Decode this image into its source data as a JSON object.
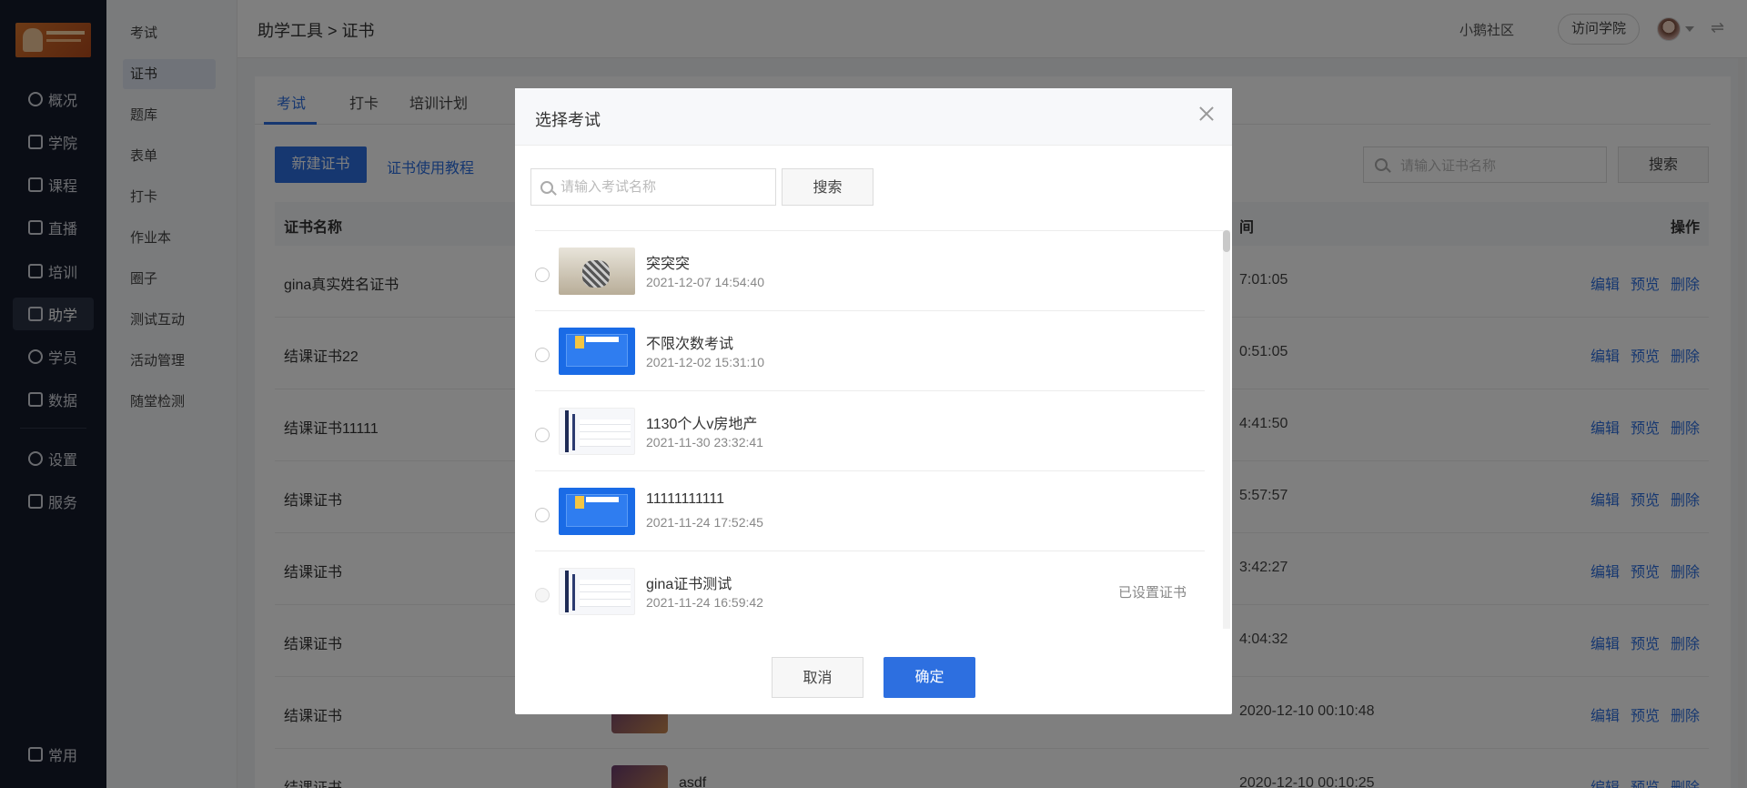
{
  "nav": {
    "items": [
      {
        "label": "概况"
      },
      {
        "label": "学院"
      },
      {
        "label": "课程"
      },
      {
        "label": "直播"
      },
      {
        "label": "培训"
      },
      {
        "label": "助学"
      },
      {
        "label": "学员"
      },
      {
        "label": "数据"
      },
      {
        "label": "设置"
      },
      {
        "label": "服务"
      }
    ],
    "bottom": "常用"
  },
  "subnav": {
    "items": [
      {
        "label": "考试"
      },
      {
        "label": "证书"
      },
      {
        "label": "题库"
      },
      {
        "label": "表单"
      },
      {
        "label": "打卡"
      },
      {
        "label": "作业本"
      },
      {
        "label": "圈子"
      },
      {
        "label": "测试互动"
      },
      {
        "label": "活动管理"
      },
      {
        "label": "随堂检测"
      }
    ]
  },
  "topbar": {
    "breadcrumb": "助学工具 > 证书",
    "community": "小鹅社区",
    "visit": "访问学院"
  },
  "main": {
    "tabs": [
      {
        "label": "考试"
      },
      {
        "label": "打卡"
      },
      {
        "label": "培训计划"
      }
    ],
    "new_button": "新建证书",
    "tutorial_link": "证书使用教程",
    "search_placeholder": "请输入证书名称",
    "search_button": "搜索",
    "table": {
      "col_name": "证书名称",
      "col_time": "间",
      "col_ops": "操作",
      "ops": [
        "编辑",
        "预览",
        "删除"
      ],
      "rows": [
        {
          "name": "gina真实姓名证书",
          "time": "7:01:05",
          "sub": ""
        },
        {
          "name": "结课证书22",
          "time": "0:51:05",
          "sub": ""
        },
        {
          "name": "结课证书11111",
          "time": "4:41:50",
          "sub": ""
        },
        {
          "name": "结课证书",
          "time": "5:57:57",
          "sub": ""
        },
        {
          "name": "结课证书",
          "time": "3:42:27",
          "sub": ""
        },
        {
          "name": "结课证书",
          "time": "4:04:32",
          "sub": ""
        },
        {
          "name": "结课证书",
          "time": "2020-12-10 00:10:48",
          "sub": ""
        },
        {
          "name": "结课证书",
          "time": "2020-12-10 00:10:25",
          "sub": "asdf"
        }
      ]
    }
  },
  "modal": {
    "title": "选择考试",
    "search_placeholder": "请输入考试名称",
    "search_button": "搜索",
    "items": [
      {
        "name": "突突突",
        "date": "2021-12-07 14:54:40",
        "badge": "",
        "thumb": "photo"
      },
      {
        "name": "不限次数考试",
        "date": "2021-12-02 15:31:10",
        "badge": "",
        "thumb": "blue"
      },
      {
        "name": "1130个人v房地产",
        "date": "2021-11-30 23:32:41",
        "badge": "",
        "thumb": "white"
      },
      {
        "name": "11111111111",
        "date": "2021-11-24 17:52:45",
        "badge": "",
        "thumb": "blue"
      },
      {
        "name": "gina证书测试",
        "date": "2021-11-24 16:59:42",
        "badge": "已设置证书",
        "thumb": "white"
      }
    ],
    "cancel": "取消",
    "confirm": "确定"
  }
}
